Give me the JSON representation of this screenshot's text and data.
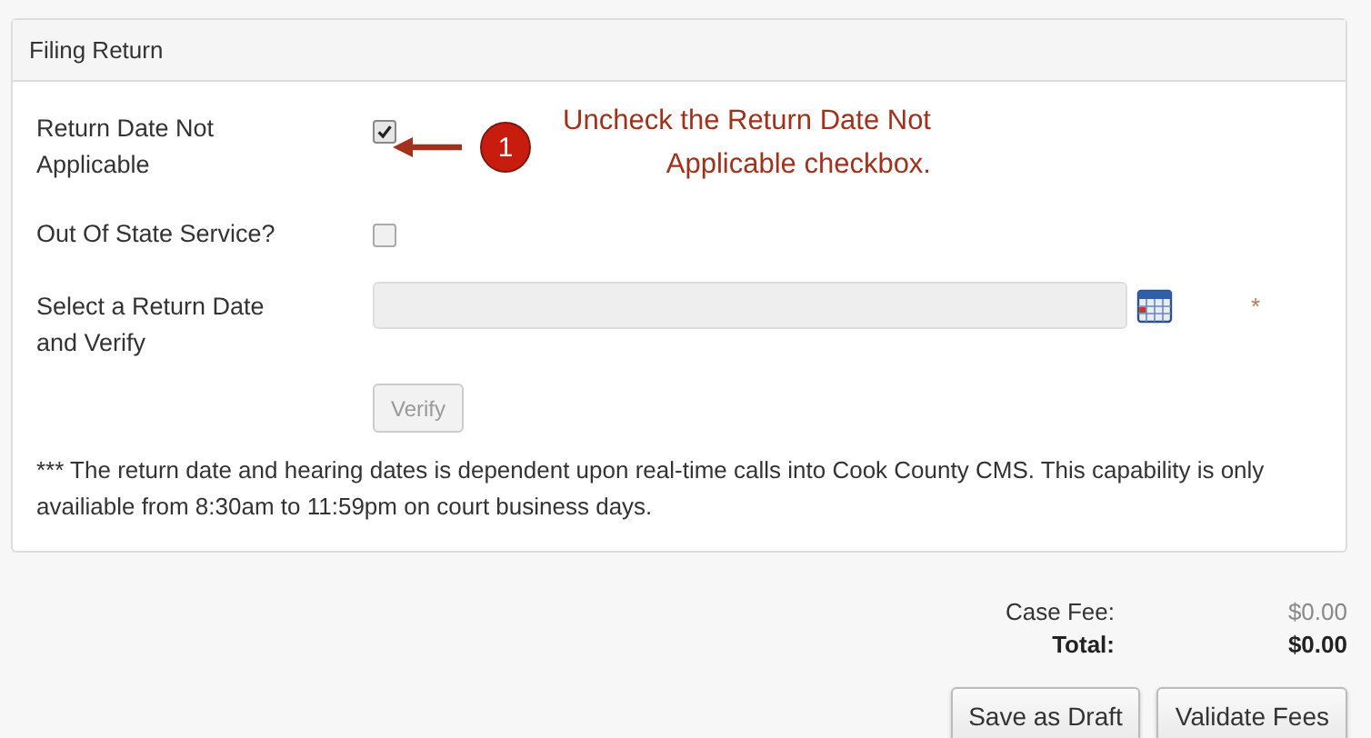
{
  "panel": {
    "title": "Filing Return",
    "fields": [
      {
        "kind": "checkbox",
        "label": "Return Date Not Applicable",
        "checked": true
      },
      {
        "kind": "checkbox",
        "label": "Out Of State Service?",
        "checked": false
      },
      {
        "kind": "date",
        "label": "Select a Return Date and Verify",
        "disabled": true,
        "required_mark": "*"
      }
    ],
    "verify_button": {
      "label": "Verify",
      "disabled": true
    },
    "note": "*** The return date and hearing dates is dependent upon real-time calls into Cook County CMS. This capability is only availiable from 8:30am to 11:59pm on court business days."
  },
  "annotation": {
    "number": "1",
    "text": "Uncheck the Return Date Not Applicable checkbox."
  },
  "fees": [
    {
      "kind": "subtotal",
      "label": "Case Fee:",
      "value": "$0.00"
    },
    {
      "kind": "total",
      "label": "Total:",
      "value": "$0.00"
    }
  ],
  "buttons": [
    "Save as Draft",
    "Validate Fees"
  ]
}
